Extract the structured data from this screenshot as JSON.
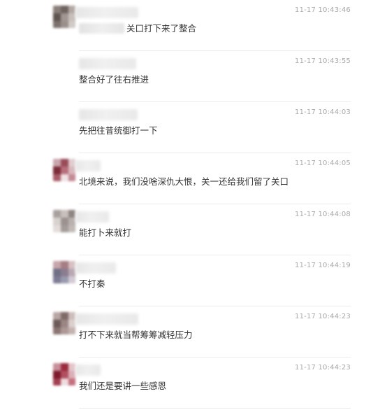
{
  "messages": [
    {
      "time": "11-17 10:43:46",
      "text": "关口打下来了整合",
      "has_avatar": true,
      "avatar": [
        "#8b7f7a",
        "#6f6360",
        "#b3a8a4",
        "#5e5450",
        "#a09792",
        "#c8bfbb",
        "#7c716e",
        "#9a8f8b",
        "#d1cac7"
      ],
      "redacted_prefix": true
    },
    {
      "time": "11-17 10:43:55",
      "text": "整合好了往右推进",
      "has_avatar": false,
      "avatar": [],
      "redacted_prefix": false
    },
    {
      "time": "11-17 10:44:03",
      "text": "先把往昔统御打一下",
      "has_avatar": false,
      "avatar": [],
      "redacted_prefix": false
    },
    {
      "time": "11-17 10:44:05",
      "text": "北境来说，我们没啥深仇大恨，关一还给我们留了关口",
      "has_avatar": true,
      "avatar": [
        "#c9a6ad",
        "#9a4b58",
        "#e0cdd1",
        "#7a2c38",
        "#b86e7b",
        "#d9b9bf",
        "#a85c69",
        "#efe2e5",
        "#c38b96"
      ],
      "redacted_prefix": false
    },
    {
      "time": "11-17 10:44:08",
      "text": "能打卜来就打",
      "has_avatar": true,
      "avatar": [
        "#a8a09d",
        "#c7c0bd",
        "#8d8481",
        "#d8d2cf",
        "#9b928f",
        "#b9b1ae",
        "#e2dcda",
        "#a49c99",
        "#c1bab7"
      ],
      "redacted_prefix": false
    },
    {
      "time": "11-17 10:44:19",
      "text": "不打秦",
      "has_avatar": true,
      "avatar": [
        "#c7a6aa",
        "#a77c84",
        "#d8c0c3",
        "#6f6f86",
        "#8a7d90",
        "#b9a9b3",
        "#7d7c95",
        "#9a9aaf",
        "#d3cbd3"
      ],
      "redacted_prefix": false
    },
    {
      "time": "11-17 10:44:23",
      "text": "打不下来就当帮筹筹减轻压力",
      "has_avatar": true,
      "avatar": [
        "#b8a6a4",
        "#7f6a68",
        "#cdbdbb",
        "#6d5a58",
        "#9c8684",
        "#dcd0cf",
        "#8c7573",
        "#ad9896",
        "#c4b2b0"
      ],
      "redacted_prefix": false
    },
    {
      "time": "11-17 10:44:23",
      "text": "我们还是要讲一些感恩",
      "has_avatar": true,
      "avatar": [
        "#c78f99",
        "#9b2a3c",
        "#e4c6cb",
        "#7d1b2d",
        "#b04f60",
        "#dcb0b8",
        "#a33e50",
        "#efdde0",
        "#c46f7e"
      ],
      "redacted_prefix": false
    }
  ]
}
